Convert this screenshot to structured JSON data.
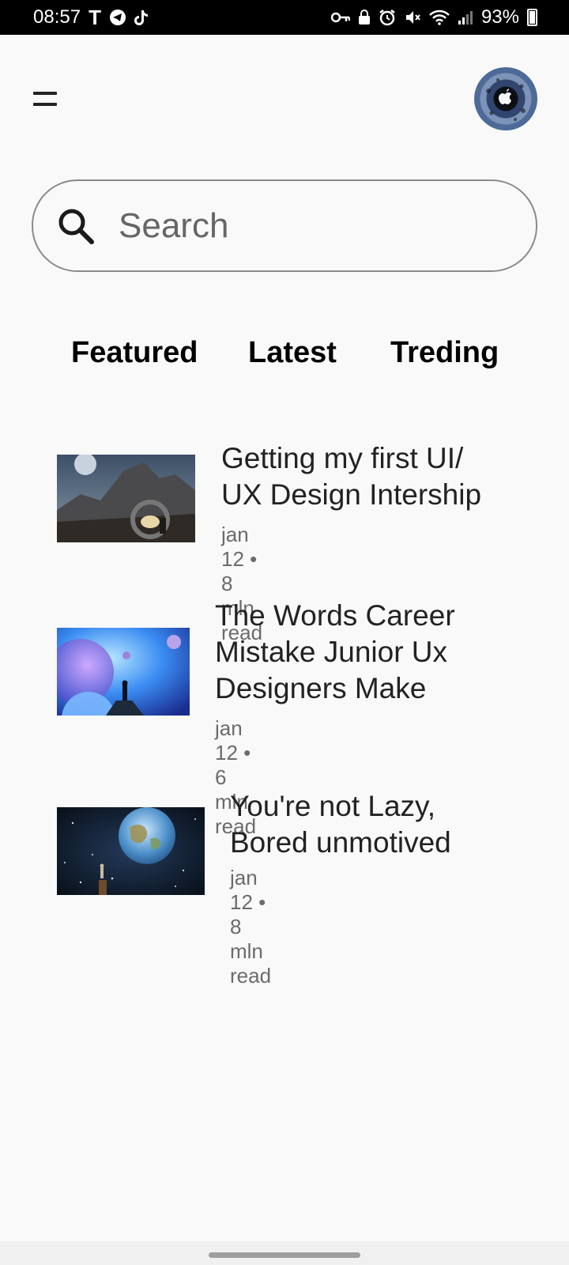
{
  "status_bar": {
    "time": "08:57",
    "left_icons": [
      "T",
      "telegram-icon",
      "tiktok-icon"
    ],
    "battery": "93%"
  },
  "header": {
    "menu_icon": "hamburger-menu-icon",
    "avatar_icon": "avatar-icon"
  },
  "search": {
    "placeholder": "Search",
    "value": "",
    "icon": "search-icon"
  },
  "tabs": [
    {
      "label": "Featured"
    },
    {
      "label": "Latest"
    },
    {
      "label": "Treding"
    }
  ],
  "articles": [
    {
      "title_lines": [
        "Getting my first UI/",
        "UX Design Intership"
      ],
      "meta": "jan 12 • 8 mln read"
    },
    {
      "title_lines": [
        "The Words Career",
        "Mistake Junior Ux",
        "Designers Make"
      ],
      "meta": "jan 12 • 6 mln read"
    },
    {
      "title_lines": [
        "You're not Lazy,",
        "Bored unmotived"
      ],
      "meta": "jan 12 • 8 mln read"
    }
  ],
  "colors": {
    "background": "#f9f9f9",
    "text": "#1f1f1f",
    "meta_text": "#6b6b6b",
    "search_border": "#8a8a8a"
  }
}
